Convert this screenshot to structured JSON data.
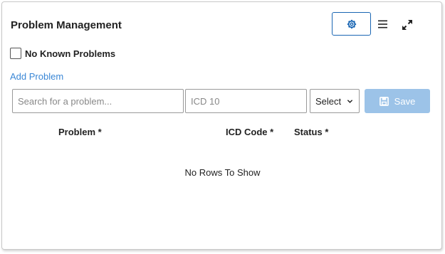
{
  "header": {
    "title": "Problem Management"
  },
  "no_known_problems": {
    "label": "No Known Problems",
    "checked": false
  },
  "add_problem_label": "Add Problem",
  "form": {
    "search_placeholder": "Search for a problem...",
    "icd_placeholder": "ICD 10",
    "status_select_value": "Select",
    "save_label": "Save"
  },
  "table": {
    "columns": [
      "Problem *",
      "ICD Code *",
      "Status *"
    ],
    "empty_message": "No Rows To Show"
  },
  "colors": {
    "accent": "#1a66b3",
    "link": "#3a87d6",
    "save_disabled": "#9cc3e8"
  },
  "icons": {
    "settings": "gear-icon",
    "menu": "hamburger-icon",
    "expand": "expand-icon",
    "save": "floppy-disk-icon",
    "select": "chevron-down-icon"
  }
}
